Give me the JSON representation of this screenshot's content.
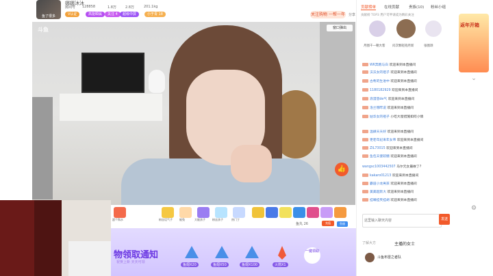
{
  "header": {
    "streamer_name": "娜娜沐沐",
    "avatar_caption": "鱼了很多",
    "stat1": "房间号",
    "room_id": "128858",
    "stat2": "1.8万",
    "stat3": "2.8万",
    "popularity": "201.1kg",
    "tags": [
      "V认证",
      "高能瞬属",
      "关注 4",
      "超级中屏",
      "小于青 18"
    ],
    "follow_label": "关注购物 一帮一年",
    "share": "分享",
    "report": "举报"
  },
  "video": {
    "logo": "斗鱼",
    "popout": "窗口弹出"
  },
  "gifts": {
    "labels": [
      "超个购水",
      "粉丝话气子",
      "能兔",
      "大能孩子",
      "粉丝孩子",
      "热门丁"
    ],
    "fishball": "鱼丸 26",
    "recharge": "充值",
    "fishwing": "鱼翅"
  },
  "banner": {
    "title": "物领取通知",
    "subtitle": "祝贺上新 天天可领",
    "items": [
      "鱼翅X20",
      "鱼翅X50",
      "鱼翅X100",
      "火箭X1"
    ],
    "one_click": "一键领取"
  },
  "right": {
    "tabs": [
      "贡献榜单",
      "在线贡献",
      "贵族(10)",
      "粉丝小组"
    ],
    "rank_note": "贡献榜 TOP3 用户可申请成为精彩关注",
    "rank_names": [
      "月图千一朝大客",
      "问次颗轻抱月新",
      "张图颉"
    ],
    "chat": [
      {
        "user": "WK奔跑与白",
        "text": "欢迎来到本直播间"
      },
      {
        "user": "沃沃女的祖子",
        "text": "欢迎来到本直播间"
      },
      {
        "user": "古希的生进中",
        "text": "欢迎来到本直播间"
      },
      {
        "user": "1180182929",
        "text": "欢迎来到本直播间"
      },
      {
        "user": "浪漫怒de气",
        "text": "欢迎来到本直播间"
      },
      {
        "user": "洛兰哦昨说",
        "text": "欢迎来到本直播间"
      },
      {
        "user": "姑华女的祖子",
        "text": "小吃大窗措施如何小情"
      },
      {
        "user": "温肆天天好",
        "text": "欢迎来到本直播间"
      },
      {
        "user": "更老年纪来年女帝",
        "text": "欢迎来到本直播间"
      },
      {
        "user": "ZIL73015",
        "text": "欢迎来到本直播间"
      },
      {
        "user": "鱼包天使软糖",
        "text": "欢迎来到本直播间"
      },
      {
        "user": "wangsc1003442507",
        "text": "马尔元女最故了?"
      },
      {
        "user": "kakaro01213",
        "text": "欢迎来到本直播间"
      },
      {
        "user": "霸道小龙男孩",
        "text": "欢迎来到本直播间"
      },
      {
        "user": "美美超默大",
        "text": "欢迎来到本直播间"
      },
      {
        "user": "挂嘴挂笑挂胡",
        "text": "欢迎来到本直播间"
      }
    ],
    "input_placeholder": "这里输入聊天内容",
    "send": "发送",
    "fans_more": "了解大方",
    "fans_title": "主播的女士",
    "fans_item": "斗鱼布雷之者队"
  },
  "promo": {
    "text": "返年开箱"
  }
}
